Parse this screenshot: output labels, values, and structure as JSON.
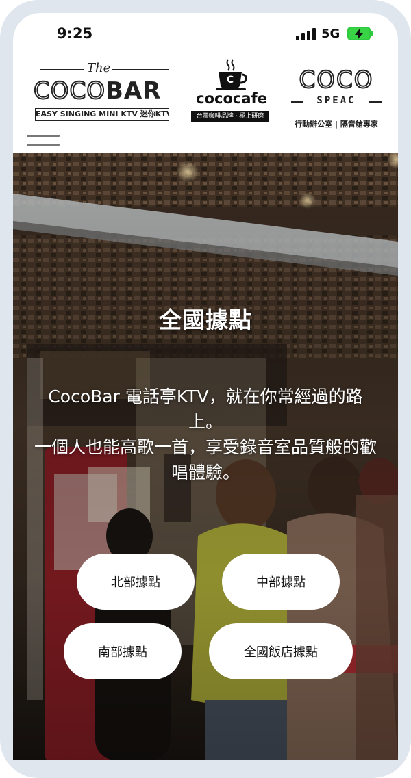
{
  "status_bar": {
    "time": "9:25",
    "network": "5G",
    "icons": [
      "signal-icon",
      "battery-charging-icon"
    ],
    "battery_color": "#39d445"
  },
  "header": {
    "logos": {
      "cocobar": {
        "small_text": "The",
        "brand_outline": "COCO",
        "brand_solid": "BAR",
        "tagline": "EASY SINGING MINI KTV 迷你KTV"
      },
      "cococafe": {
        "cup_mark": "C",
        "brand": "cococafe",
        "tagline": "台灣咖啡品牌 · 極上研磨"
      },
      "cocospeac": {
        "brand": "COCO",
        "sub_brand": "SPEAC",
        "tagline": "行動辦公室 | 隔音艙專家"
      }
    },
    "menu_icon": "hamburger-menu-icon"
  },
  "hero": {
    "title": "全國據點",
    "description_line1": "CocoBar 電話亭KTV，就在你常經過的路上。",
    "description_line2": "一個人也能高歌一首，享受錄音室品質般的歡唱體驗。",
    "buttons": {
      "north": "北部據點",
      "central": "中部據點",
      "south": "南部據點",
      "hotel": "全國飯店據點"
    }
  },
  "colors": {
    "frame": "#dfe6ee",
    "button_bg": "#ffffff",
    "text_dark": "#111111"
  }
}
